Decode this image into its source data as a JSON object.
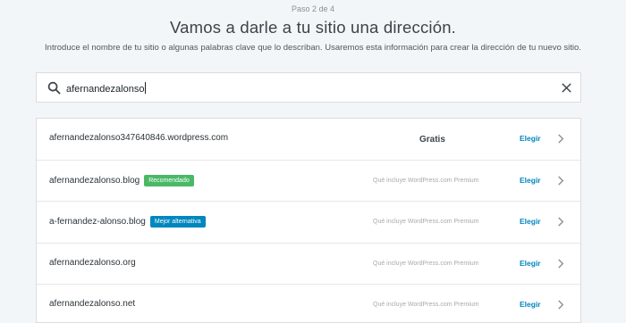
{
  "header": {
    "step": "Paso 2 de 4",
    "title": "Vamos a darle a tu sitio una dirección.",
    "subtitle": "Introduce el nombre de tu sitio o algunas palabras clave que lo describan. Usaremos esta información para crear la dirección de tu nuevo sitio."
  },
  "search": {
    "value": "afernandezalonso",
    "icon": "search-icon",
    "clear_icon": "close-icon"
  },
  "results": [
    {
      "domain": "afernandezalonso347640846.wordpress.com",
      "badge": "",
      "price": "Gratis",
      "note": "",
      "action": "Elegir"
    },
    {
      "domain": "afernandezalonso.blog",
      "badge": "Recomendado",
      "price": "",
      "note": "Qué incluye WordPress.com Premium",
      "action": "Elegir"
    },
    {
      "domain": "a-fernandez-alonso.blog",
      "badge": "Mejor alternativa",
      "price": "",
      "note": "Qué incluye WordPress.com Premium",
      "action": "Elegir"
    },
    {
      "domain": "afernandezalonso.org",
      "badge": "",
      "price": "",
      "note": "Qué incluye WordPress.com Premium",
      "action": "Elegir"
    },
    {
      "domain": "afernandezalonso.net",
      "badge": "",
      "price": "",
      "note": "Qué incluye WordPress.com Premium",
      "action": "Elegir"
    }
  ],
  "colors": {
    "background": "#f3f6f8",
    "link": "#0087be",
    "badge_recommended": "#4ab866",
    "badge_alternative": "#0087be"
  }
}
